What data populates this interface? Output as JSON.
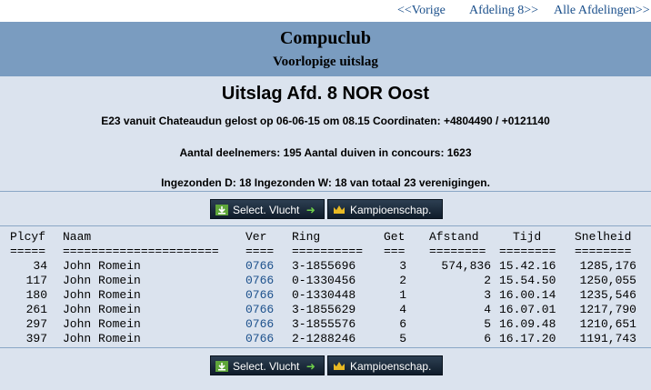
{
  "nav": {
    "prev": "<<Vorige",
    "section": "Afdeling 8>>",
    "all": "Alle Afdelingen>>"
  },
  "banner": {
    "club": "Compuclub",
    "subtitle": "Voorlopige uitslag"
  },
  "info": {
    "title": "Uitslag Afd. 8 NOR Oost",
    "line1": "E23 vanuit Chateaudun gelost op 06-06-15 om 08.15 Coordinaten: +4804490 / +0121140",
    "line2": "Aantal deelnemers: 195 Aantal duiven in concours: 1623",
    "line3": "Ingezonden D: 18 Ingezonden W: 18 van totaal 23 verenigingen."
  },
  "buttons": {
    "select_flight": "Select. Vlucht",
    "championship": "Kampioenschap."
  },
  "colors": {
    "banner": "#7a9cc0",
    "background": "#dbe3ee",
    "link": "#1a4f8b"
  },
  "table": {
    "headers": {
      "plcyf": "Plcyf",
      "naam": "Naam",
      "ver": "Ver",
      "ring": "Ring",
      "get": "Get",
      "afstand": "Afstand",
      "tijd": "Tijd",
      "snelheid": "Snelheid"
    },
    "underline": {
      "plcyf": "=====",
      "naam": "======================",
      "ver": "====",
      "ring": "==========",
      "get": "===",
      "afstand": "========",
      "tijd": "========",
      "snelheid": "========"
    },
    "rows": [
      {
        "plcyf": "34",
        "naam": "John Romein",
        "ver": "0766",
        "ring": "3-1855696",
        "get": "3",
        "afstand": "574,836",
        "tijd": "15.42.16",
        "snelheid": "1285,176"
      },
      {
        "plcyf": "117",
        "naam": "John Romein",
        "ver": "0766",
        "ring": "0-1330456",
        "get": "2",
        "afstand": "2",
        "tijd": "15.54.50",
        "snelheid": "1250,055"
      },
      {
        "plcyf": "180",
        "naam": "John Romein",
        "ver": "0766",
        "ring": "0-1330448",
        "get": "1",
        "afstand": "3",
        "tijd": "16.00.14",
        "snelheid": "1235,546"
      },
      {
        "plcyf": "261",
        "naam": "John Romein",
        "ver": "0766",
        "ring": "3-1855629",
        "get": "4",
        "afstand": "4",
        "tijd": "16.07.01",
        "snelheid": "1217,790"
      },
      {
        "plcyf": "297",
        "naam": "John Romein",
        "ver": "0766",
        "ring": "3-1855576",
        "get": "6",
        "afstand": "5",
        "tijd": "16.09.48",
        "snelheid": "1210,651"
      },
      {
        "plcyf": "397",
        "naam": "John Romein",
        "ver": "0766",
        "ring": "2-1288246",
        "get": "5",
        "afstand": "6",
        "tijd": "16.17.20",
        "snelheid": "1191,743"
      }
    ]
  }
}
